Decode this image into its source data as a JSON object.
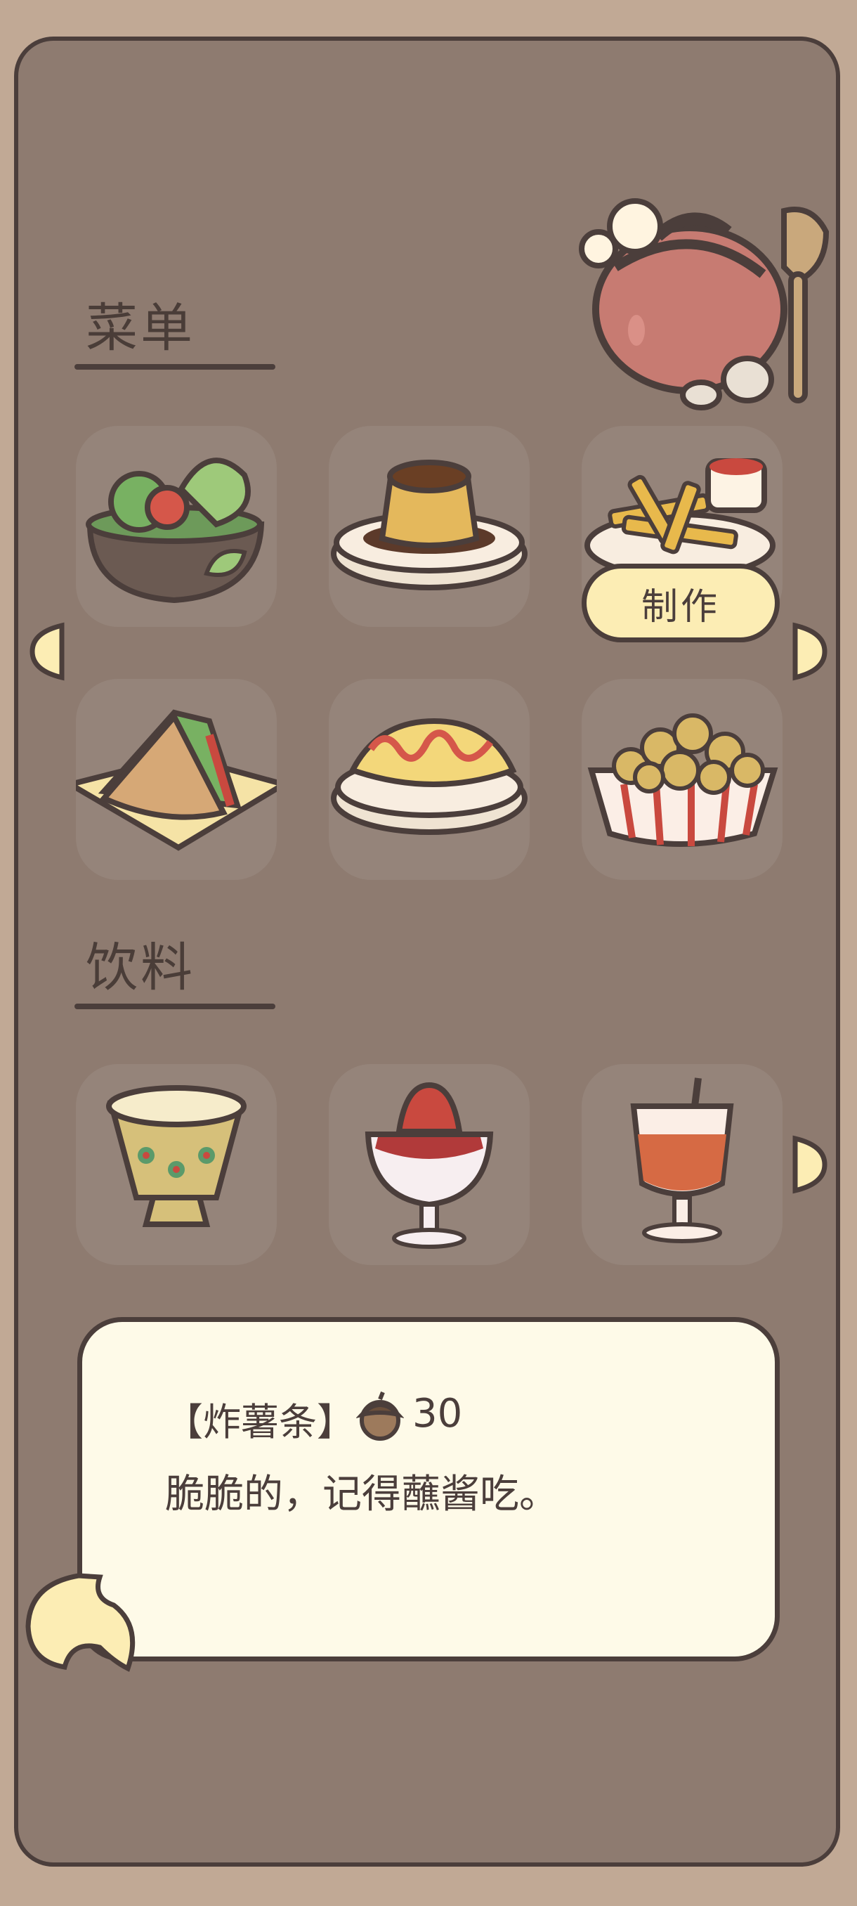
{
  "sections": {
    "menu_title": "菜单",
    "drinks_title": "饮料"
  },
  "menu_items": [
    {
      "icon": "salad-bowl-icon"
    },
    {
      "icon": "pudding-icon"
    },
    {
      "icon": "french-fries-icon"
    },
    {
      "icon": "sandwich-icon"
    },
    {
      "icon": "omelette-icon"
    },
    {
      "icon": "popcorn-chicken-icon"
    }
  ],
  "drink_items": [
    {
      "icon": "tea-cup-icon"
    },
    {
      "icon": "strawberry-parfait-icon"
    },
    {
      "icon": "juice-glass-icon"
    }
  ],
  "make_button": "制作",
  "description": {
    "name": "【炸薯条】",
    "price": "30",
    "currency_icon": "acorn-icon",
    "text": "脆脆的，记得蘸酱吃。"
  },
  "colors": {
    "background": "#c1a995",
    "panel": "#8e7b70",
    "slot": "#95847a",
    "outline": "#4b3e3b",
    "accent": "#fcedb4"
  }
}
